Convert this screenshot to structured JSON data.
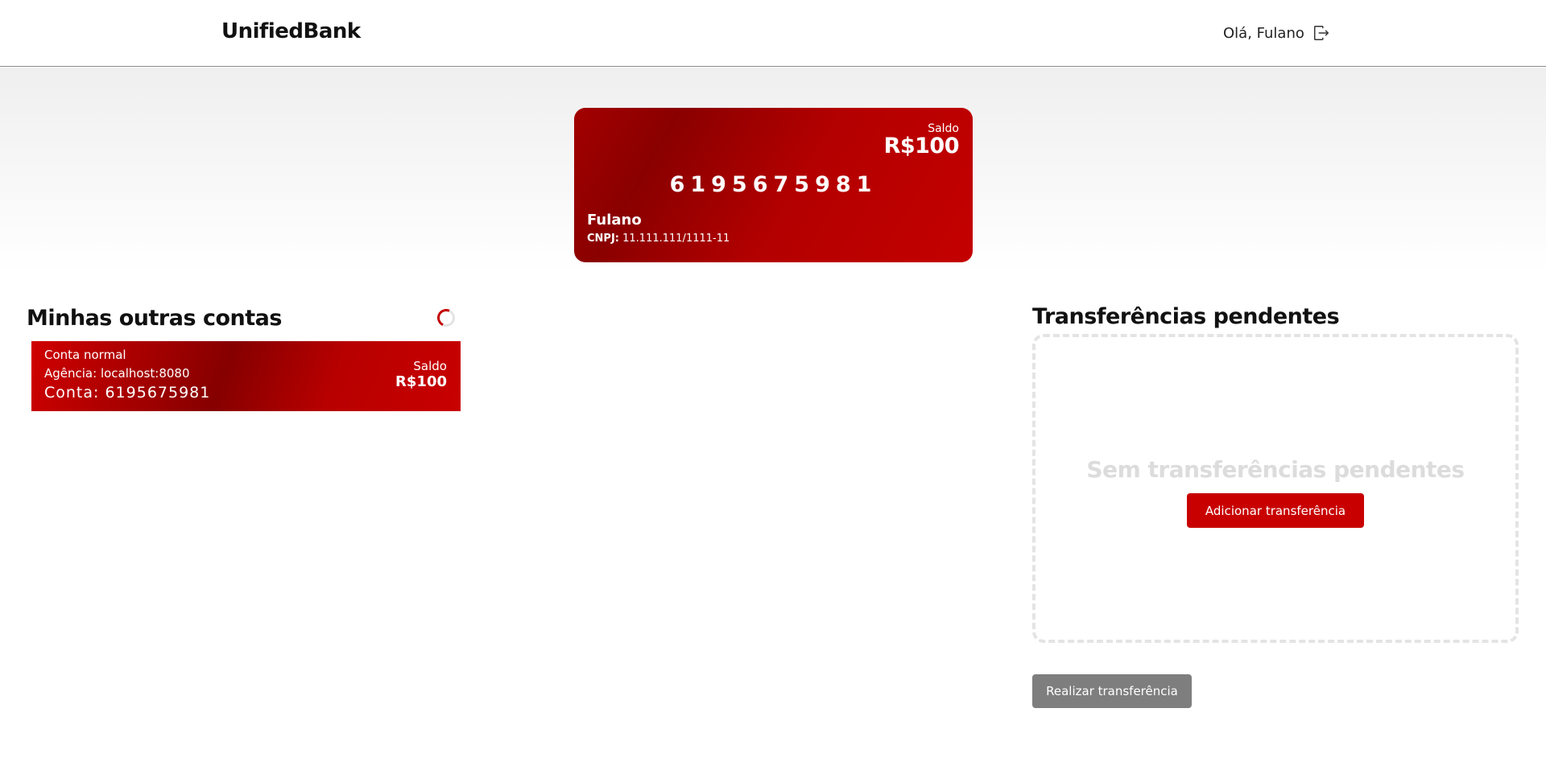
{
  "header": {
    "brand": "UnifiedBank",
    "greeting": "Olá, Fulano",
    "logout_icon": "logout-icon"
  },
  "main_account": {
    "balance_label": "Saldo",
    "balance": "R$100",
    "account_number": "6195675981",
    "holder": "Fulano",
    "doc_label": "CNPJ:",
    "doc_value": "11.111.111/1111-11"
  },
  "other_accounts": {
    "title": "Minhas outras contas",
    "items": [
      {
        "type": "Conta normal",
        "agency": "Agência: localhost:8080",
        "account": "Conta: 6195675981",
        "balance_label": "Saldo",
        "balance": "R$100"
      }
    ]
  },
  "pending": {
    "title": "Transferências pendentes",
    "empty_message": "Sem transferências pendentes",
    "add_button": "Adicionar transferência"
  },
  "actions": {
    "transfer_button": "Realizar transferência"
  },
  "colors": {
    "accent": "#c80000",
    "dark_red": "#8a0000",
    "disabled_gray": "#7e7e7e"
  }
}
